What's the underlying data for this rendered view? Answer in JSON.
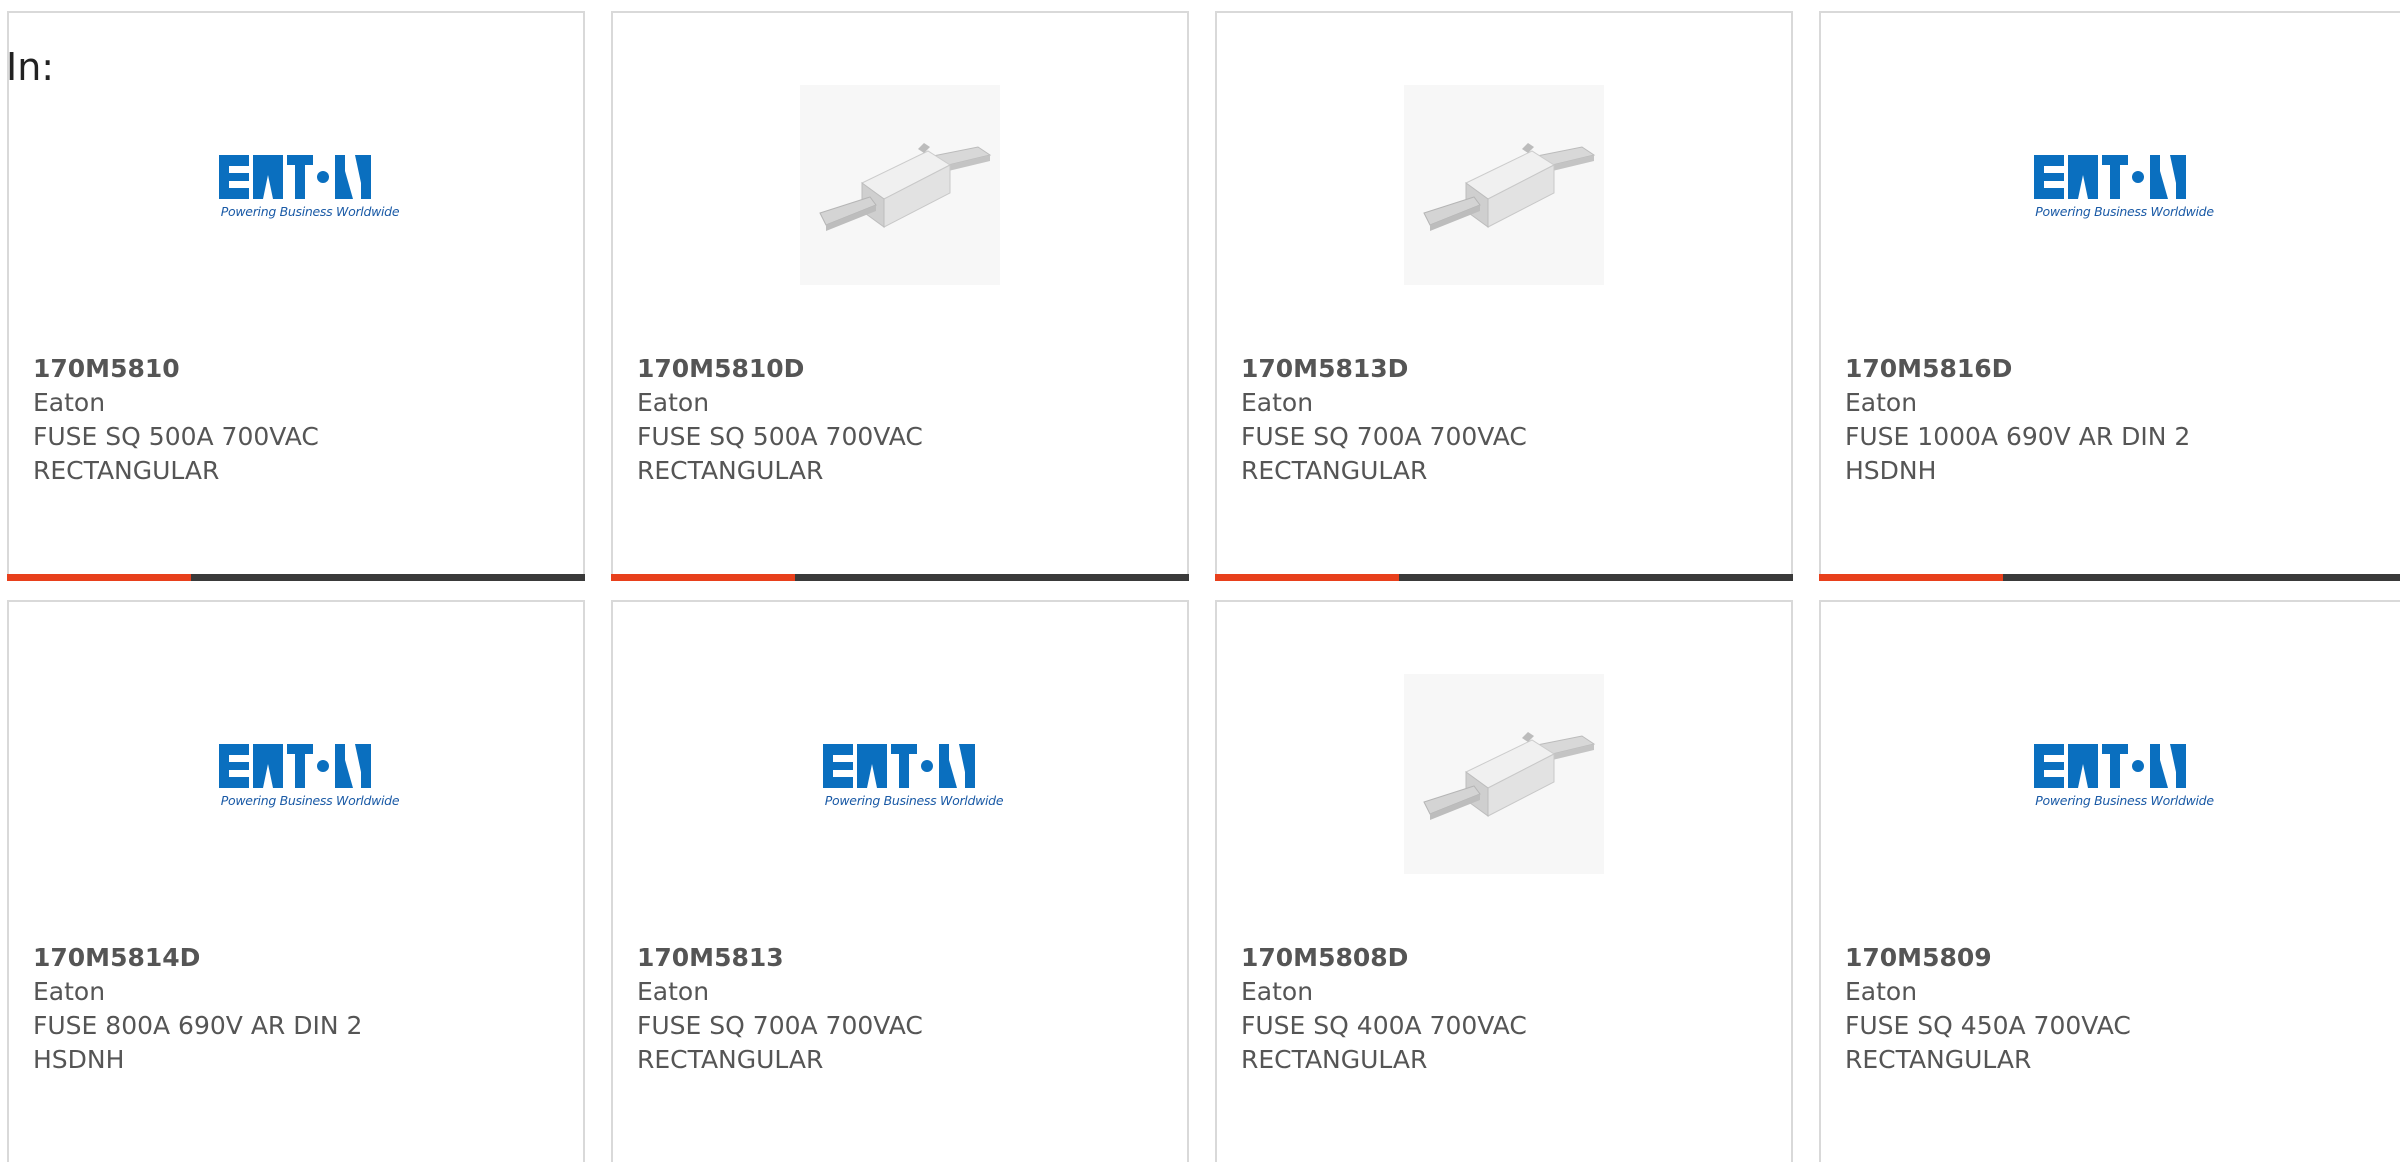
{
  "in_label": "In:",
  "brand": {
    "tagline": "Powering Business Worldwide",
    "blue": "#0a6fbf",
    "accent": "#e8401c"
  },
  "products": [
    {
      "part": "170M5810",
      "mfr": "Eaton",
      "desc1": "FUSE SQ 500A 700VAC",
      "desc2": "RECTANGULAR",
      "image": "eaton-logo"
    },
    {
      "part": "170M5810D",
      "mfr": "Eaton",
      "desc1": "FUSE SQ 500A 700VAC",
      "desc2": "RECTANGULAR",
      "image": "fuse-photo"
    },
    {
      "part": "170M5813D",
      "mfr": "Eaton",
      "desc1": "FUSE SQ 700A 700VAC",
      "desc2": "RECTANGULAR",
      "image": "fuse-photo"
    },
    {
      "part": "170M5816D",
      "mfr": "Eaton",
      "desc1": "FUSE 1000A 690V AR DIN 2",
      "desc2": "HSDNH",
      "image": "eaton-logo"
    },
    {
      "part": "170M5814D",
      "mfr": "Eaton",
      "desc1": "FUSE 800A 690V AR DIN 2",
      "desc2": "HSDNH",
      "image": "eaton-logo"
    },
    {
      "part": "170M5813",
      "mfr": "Eaton",
      "desc1": "FUSE SQ 700A 700VAC",
      "desc2": "RECTANGULAR",
      "image": "eaton-logo"
    },
    {
      "part": "170M5808D",
      "mfr": "Eaton",
      "desc1": "FUSE SQ 400A 700VAC",
      "desc2": "RECTANGULAR",
      "image": "fuse-photo"
    },
    {
      "part": "170M5809",
      "mfr": "Eaton",
      "desc1": "FUSE SQ 450A 700VAC",
      "desc2": "RECTANGULAR",
      "image": "eaton-logo"
    }
  ]
}
